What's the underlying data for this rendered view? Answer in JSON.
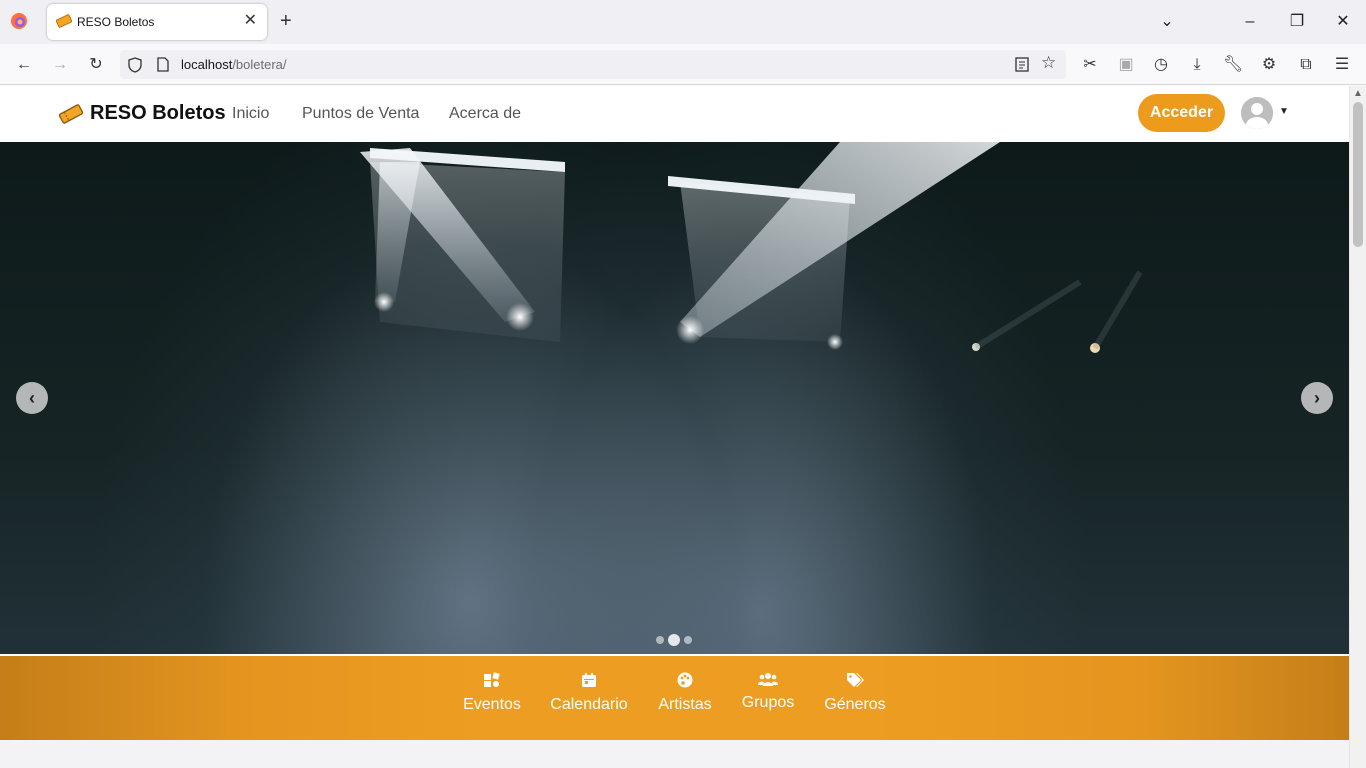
{
  "browser": {
    "tab_title": "RESO Boletos",
    "url_host": "localhost",
    "url_path": "/boletera/"
  },
  "site": {
    "brand": "RESO Boletos",
    "nav_links": [
      "Inicio",
      "Puntos de Venta",
      "Acerca de"
    ],
    "login_label": "Acceder"
  },
  "carousel": {
    "slide_count": 3,
    "active_slide": 2
  },
  "categories": [
    {
      "label": "Eventos",
      "icon": "events-icon"
    },
    {
      "label": "Calendario",
      "icon": "calendar-icon"
    },
    {
      "label": "Artistas",
      "icon": "palette-icon"
    },
    {
      "label": "Grupos",
      "icon": "group-icon"
    },
    {
      "label": "Géneros",
      "icon": "tags-icon"
    }
  ],
  "colors": {
    "accent": "#ec9b1c",
    "category_bar": "#ed9d21"
  }
}
